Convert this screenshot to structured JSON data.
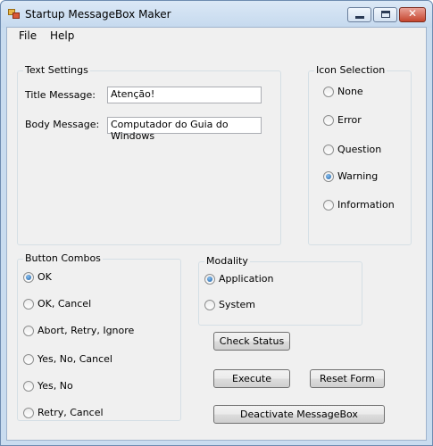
{
  "window": {
    "title": "Startup MessageBox Maker",
    "close_glyph": "✕"
  },
  "menu": {
    "file": "File",
    "help": "Help"
  },
  "text_settings": {
    "legend": "Text Settings",
    "title_label": "Title Message:",
    "title_value": "Atenção!",
    "body_label": "Body Message:",
    "body_value": "Computador do Guia do Windows"
  },
  "icon_selection": {
    "legend": "Icon Selection",
    "options": [
      "None",
      "Error",
      "Question",
      "Warning",
      "Information"
    ],
    "selected": "Warning"
  },
  "button_combos": {
    "legend": "Button Combos",
    "options": [
      "OK",
      "OK, Cancel",
      "Abort, Retry, Ignore",
      "Yes, No, Cancel",
      "Yes, No",
      "Retry, Cancel"
    ],
    "selected": "OK"
  },
  "modality": {
    "legend": "Modality",
    "options": [
      "Application",
      "System"
    ],
    "selected": "Application"
  },
  "buttons": {
    "check_status": "Check Status",
    "execute": "Execute",
    "reset_form": "Reset Form",
    "deactivate": "Deactivate MessageBox"
  }
}
